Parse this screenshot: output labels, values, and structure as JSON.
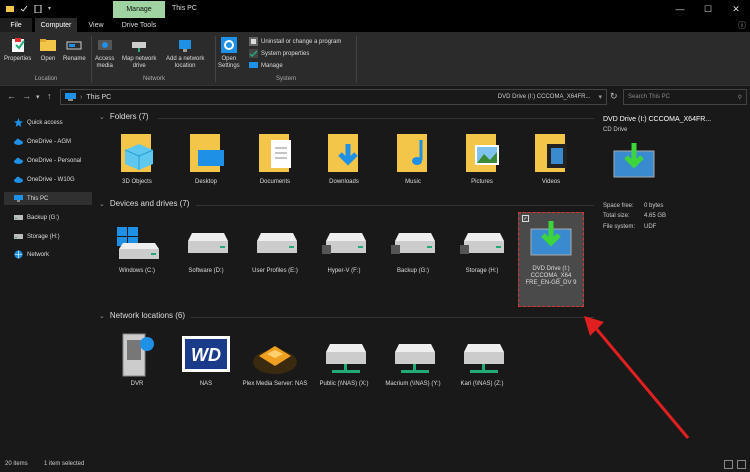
{
  "window": {
    "title": "This PC",
    "context_tab": "Manage",
    "controls": [
      "—",
      "☐",
      "✕"
    ]
  },
  "ribbon_tabs": {
    "file": "File",
    "computer": "Computer",
    "view": "View",
    "drive_tools": "Drive Tools"
  },
  "ribbon": {
    "location": {
      "label": "Location",
      "properties": "Properties",
      "open": "Open",
      "rename": "Rename"
    },
    "network": {
      "label": "Network",
      "access_media_1": "Access",
      "access_media_2": "media",
      "map_drive_1": "Map network",
      "map_drive_2": "drive",
      "add_location_1": "Add a network",
      "add_location_2": "location"
    },
    "system": {
      "label": "System",
      "open_settings_1": "Open",
      "open_settings_2": "Settings",
      "uninstall": "Uninstall or change a program",
      "system_properties": "System properties",
      "manage": "Manage"
    }
  },
  "address": {
    "path": "This PC",
    "dropdown_label": "DVD Drive (I:) CCCOMA_X64FR...",
    "search_placeholder": "Search This PC"
  },
  "sidebar": {
    "items": [
      {
        "label": "Quick access",
        "icon": "star-icon"
      },
      {
        "label": "OneDrive - AGM",
        "icon": "cloud-icon"
      },
      {
        "label": "OneDrive - Personal",
        "icon": "cloud-icon"
      },
      {
        "label": "OneDrive - W10G",
        "icon": "cloud-icon"
      },
      {
        "label": "This PC",
        "icon": "computer-icon"
      },
      {
        "label": "Backup (G:)",
        "icon": "drive-icon"
      },
      {
        "label": "Storage (H:)",
        "icon": "drive-icon"
      },
      {
        "label": "Network",
        "icon": "network-icon"
      }
    ]
  },
  "sections": {
    "folders": {
      "title": "Folders (7)",
      "items": [
        "3D Objects",
        "Desktop",
        "Documents",
        "Downloads",
        "Music",
        "Pictures",
        "Videos"
      ]
    },
    "devices": {
      "title": "Devices and drives (7)",
      "items": [
        "Windows (C:)",
        "Software (D:)",
        "User Profiles (E:)",
        "Hyper-V (F:)",
        "Backup (G:)",
        "Storage (H:)",
        "DVD Drive (I:) CCCOMA_X64 FRE_EN-GB_DV 9"
      ]
    },
    "network": {
      "title": "Network locations (6)",
      "items": [
        "DVR",
        "NAS",
        "Plex Media Server: NAS",
        "Public (\\\\NAS) (X:)",
        "Macrium (\\\\NAS) (Y:)",
        "Kari (\\\\NAS) (Z:)"
      ]
    }
  },
  "details": {
    "title": "DVD Drive (I:) CCCOMA_X64FR...",
    "subtitle": "CD Drive",
    "space_free_label": "Space free:",
    "space_free_value": "0 bytes",
    "total_size_label": "Total size:",
    "total_size_value": "4.65 GB",
    "file_system_label": "File system:",
    "file_system_value": "UDF"
  },
  "status": {
    "count": "20 items",
    "selected": "1 item selected"
  },
  "colors": {
    "background": "#191919",
    "ribbon": "#2b2b2b",
    "context_tab": "#9fd4a2",
    "folder": "#f3c64a",
    "accent_blue": "#1e90e6",
    "annotation_red": "#e02020"
  }
}
